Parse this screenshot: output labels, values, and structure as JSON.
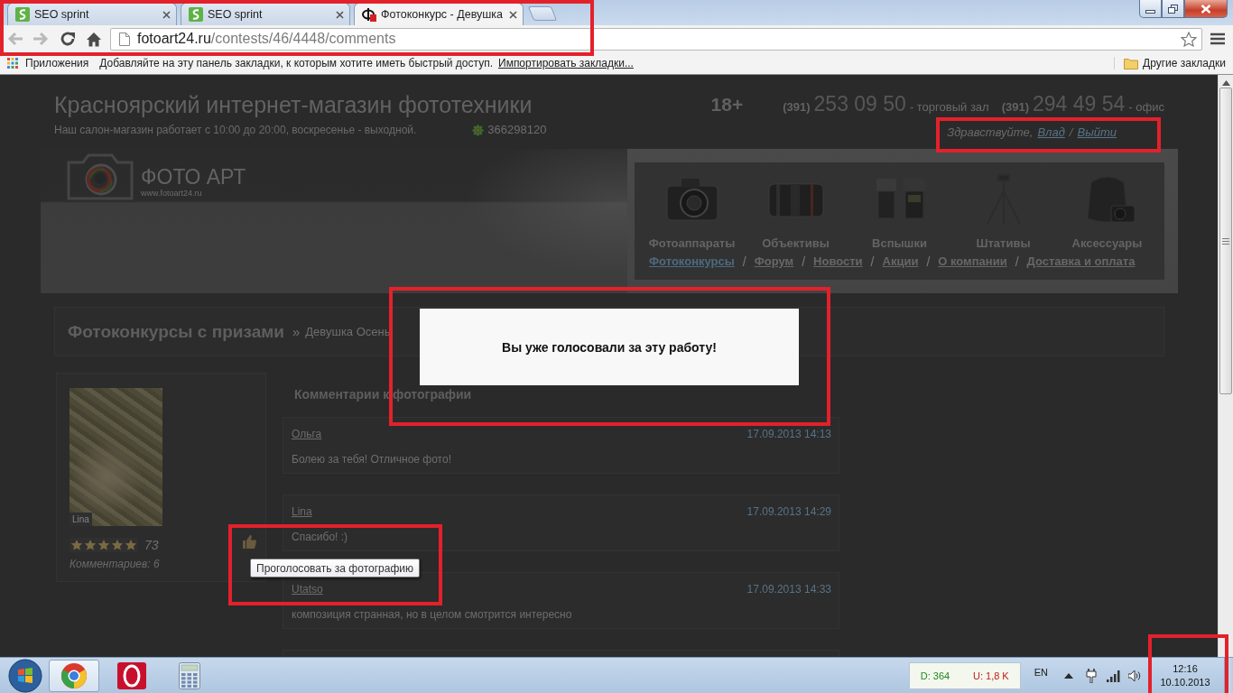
{
  "browser": {
    "tabs": [
      {
        "kind": "seo",
        "title": "SEO sprint",
        "selected": false
      },
      {
        "kind": "seo",
        "title": "SEO sprint",
        "selected": false
      },
      {
        "kind": "photo",
        "title": "Фотоконкурс - Девушка",
        "selected": true
      }
    ],
    "back_disabled": true,
    "forward_disabled": true,
    "url_host": "fotoart24.ru",
    "url_path": "/contests/46/4448/comments"
  },
  "bookmarks_bar": {
    "apps": "Приложения",
    "hint": "Добавляйте на эту панель закладки, к которым хотите иметь быстрый доступ.",
    "import_link": "Импортировать закладки...",
    "other_bookmarks": "Другие закладки"
  },
  "site_header": {
    "title": "Красноярский интернет-магазин фототехники",
    "hours": "Наш салон-магазин работает с 10:00 до 20:00, воскресенье - выходной.",
    "icq": "366298120",
    "age_rating": "18+",
    "phones": [
      {
        "code": "(391)",
        "number": "253 09 50",
        "label": "- торговый зал"
      },
      {
        "code": "(391)",
        "number": "294 49 54",
        "label": "- офис"
      }
    ],
    "greeting": "Здравствуйте,",
    "user_link": "Влад",
    "separator": "/",
    "logout_link": "Выйти"
  },
  "logo": {
    "name": "ФОТО АРТ",
    "url": "www.fotoart24.ru"
  },
  "categories": [
    {
      "kind": "camera",
      "label": "Фотоаппараты"
    },
    {
      "kind": "lens",
      "label": "Объективы"
    },
    {
      "kind": "flash",
      "label": "Вспышки"
    },
    {
      "kind": "tripod",
      "label": "Штативы"
    },
    {
      "kind": "bag",
      "label": "Аксессуары"
    }
  ],
  "nav_links": [
    {
      "label": "Фотоконкурсы",
      "selected": true
    },
    {
      "separator": "/",
      "label": "Форум",
      "selected": false
    },
    {
      "separator": "/",
      "label": "Новости",
      "selected": false
    },
    {
      "separator": "/",
      "label": "Акции",
      "selected": false
    },
    {
      "separator": "/",
      "label": "О компании",
      "selected": false
    },
    {
      "separator": "/",
      "label": "Доставка и оплата",
      "selected": false
    }
  ],
  "breadcrumb": {
    "title": "Фотоконкурсы с призами",
    "separator": "»",
    "current": "Девушка Осень"
  },
  "photo_card": {
    "author": "Lina",
    "stars": 5,
    "votes": "73",
    "comments_count": "Комментариев: 6"
  },
  "comments": {
    "heading": "Комментарии к фотографии",
    "items": [
      {
        "author": "Ольга",
        "date": "17.09.2013 14:13",
        "text": "Болею за тебя! Отличное фото!"
      },
      {
        "author": "Lina",
        "date": "17.09.2013 14:29",
        "text": "Спасибо! :)"
      },
      {
        "author": "Utatso",
        "date": "17.09.2013 14:33",
        "text": "композиция странная, но в целом смотрится интересно"
      }
    ]
  },
  "dialog": {
    "message": "Вы уже голосовали за эту работу!"
  },
  "tooltip": {
    "text": "Проголосовать за фотографию"
  },
  "taskbar": {
    "apps": [
      {
        "kind": "browser",
        "selected": true
      },
      {
        "kind": "red-app",
        "selected": false
      },
      {
        "kind": "calculator",
        "selected": false
      }
    ],
    "traffic": {
      "download": "D: 364",
      "upload": "U: 1,8 K"
    },
    "language": "EN",
    "time": "12:16",
    "date": "10.10.2013"
  }
}
